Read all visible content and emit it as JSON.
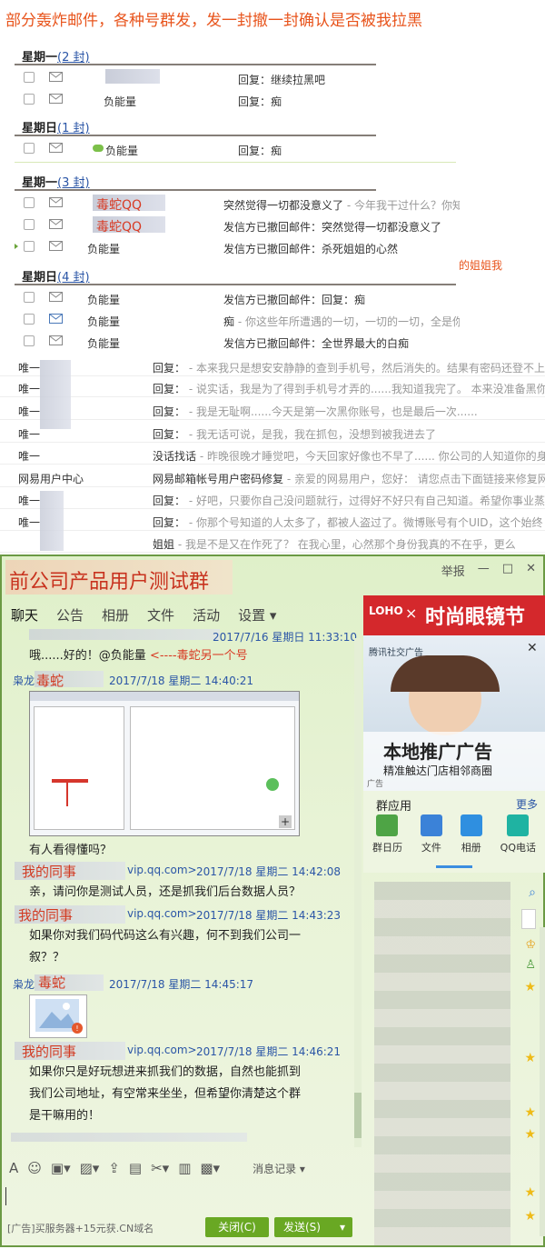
{
  "page_title": "部分轰炸邮件，各种号群发，发一封撤一封确认是否被我拉黑",
  "groups": [
    {
      "day": "星期一",
      "count": "(2 封)",
      "rows": [
        {
          "sender": "",
          "subject": "回复：继续拉黑吧",
          "subject_gray": ""
        },
        {
          "sender": "负能量",
          "subject": "回复：痴",
          "subject_gray": ""
        }
      ]
    },
    {
      "day": "星期日",
      "count": "(1 封)",
      "rows": [
        {
          "sender": "负能量",
          "subject": "回复：痴",
          "subject_gray": ""
        }
      ]
    },
    {
      "day": "星期一",
      "count": "(3 封)",
      "rows": [
        {
          "sender": "毒蛇QQ",
          "subject": "突然觉得一切都没意义了",
          "subject_gray": " - 今年我干过什么？你知"
        },
        {
          "sender": "毒蛇QQ",
          "subject": "发信方已撤回邮件：突然觉得一切都没意义了",
          "subject_gray": ""
        },
        {
          "sender": "负能量",
          "subject": "发信方已撤回邮件：杀死姐姐的心然",
          "subject_gray": ""
        }
      ]
    },
    {
      "day": "星期日",
      "count": "(4 封)",
      "rows": [
        {
          "sender": "负能量",
          "subject": "发信方已撤回邮件：回复：痴",
          "subject_gray": ""
        },
        {
          "sender": "负能量",
          "subject": "痴",
          "subject_gray": " - 你这些年所遭遇的一切，一切的一切，全是你"
        },
        {
          "sender": "负能量",
          "subject": "发信方已撤回邮件：全世界最大的白痴",
          "subject_gray": ""
        }
      ]
    }
  ],
  "side_note": "的姐姐我",
  "mail_rows": [
    {
      "sender": "唯一",
      "subject": "回复：",
      "preview": " - 本来我只是想安安静静的查到手机号，然后消失的。结果有密码还登不上"
    },
    {
      "sender": "唯一",
      "subject": "回复：",
      "preview": " - 说实话，我是为了得到手机号才弄的......我知道我完了。 本来没准备黑你"
    },
    {
      "sender": "唯一",
      "subject": "回复：",
      "preview": " - 我是无耻啊......今天是第一次黑你账号，也是最后一次......"
    },
    {
      "sender": "唯一",
      "subject": "回复：",
      "preview": " - 我无话可说，是我，我在抓包，没想到被我进去了"
    },
    {
      "sender": "唯一",
      "subject": "没话找话",
      "preview": " - 昨晚很晚才睡觉吧，今天回家好像也不早了...... 你公司的人知道你的身"
    },
    {
      "sender": "网易用户中心",
      "subject": "网易邮箱帐号用户密码修复",
      "preview": " - 亲爱的网易用户，您好： 请您点击下面链接来修复网"
    },
    {
      "sender": "唯一",
      "subject": "回复：",
      "preview": " - 好吧，只要你自己没问题就行，过得好不好只有自己知道。希望你事业蒸"
    },
    {
      "sender": "唯一",
      "subject": "回复：",
      "preview": " - 你那个号知道的人太多了，都被人盗过了。微博账号有个UID，这个始终"
    },
    {
      "sender": "",
      "subject": "姐姐",
      "preview": " - 我是不是又在作死了？ 在我心里，心然那个身份我真的不在乎，更么"
    }
  ],
  "chat": {
    "title": "前公司产品用户测试群",
    "controls": [
      "举报",
      "—",
      "□",
      "✕"
    ],
    "tabs": [
      "聊天",
      "公告",
      "相册",
      "文件",
      "活动",
      "设置 ▾"
    ],
    "messages": [
      {
        "meta": "2017/7/16 星期日 11:33:10",
        "text": "哦......好的！@负能量"
      },
      {
        "text_note": "<----毒蛇另一个号"
      },
      {
        "prefix": "枭龙",
        "name": "毒蛇",
        "meta": "2017/7/18 星期二 14:40:21"
      },
      {
        "question": "有人看得懂吗？"
      },
      {
        "name": "我的同事",
        "domain": "vip.qq.com>",
        "meta": "2017/7/18 星期二 14:42:08",
        "text": "亲，请问你是测试人员，还是抓我们后台数据人员？"
      },
      {
        "name": "我的同事",
        "domain": "vip.qq.com>",
        "meta": "2017/7/18 星期二 14:43:23",
        "text": "如果你对我们码代码这么有兴趣，何不到我们公司一",
        "text2": "叙？？"
      },
      {
        "prefix": "枭龙",
        "name": "毒蛇",
        "meta": "2017/7/18 星期二 14:45:17"
      },
      {
        "name": "我的同事",
        "domain": "vip.qq.com>",
        "meta": "2017/7/18 星期二 14:46:21",
        "text": "如果你只是好玩想进来抓我们的数据，自然也能抓到",
        "text2": "我们公司地址，有空常来坐坐，但希望你清楚这个群",
        "text3": "是干嘛用的！"
      }
    ],
    "msg_record": "消息记录 ▾",
    "footer_ad": "[广告]买服务器+15元获.CN域名",
    "close_btn": "关闭(C)",
    "send_btn": "发送(S)",
    "ad": {
      "brand": "时尚眼镜节",
      "logo": "LOHO",
      "cross": "×",
      "tencent": "腾讯社交广告",
      "headline": "本地推广广告",
      "sub": "精准触达门店相邻商圈",
      "tag": "广告"
    },
    "apps_title": "群应用",
    "apps_more": "更多",
    "apps": [
      "群日历",
      "文件",
      "相册",
      "QQ电话"
    ]
  },
  "colors": {
    "accent": "#e8541c",
    "link": "#2a55a6",
    "green": "#69a823"
  }
}
